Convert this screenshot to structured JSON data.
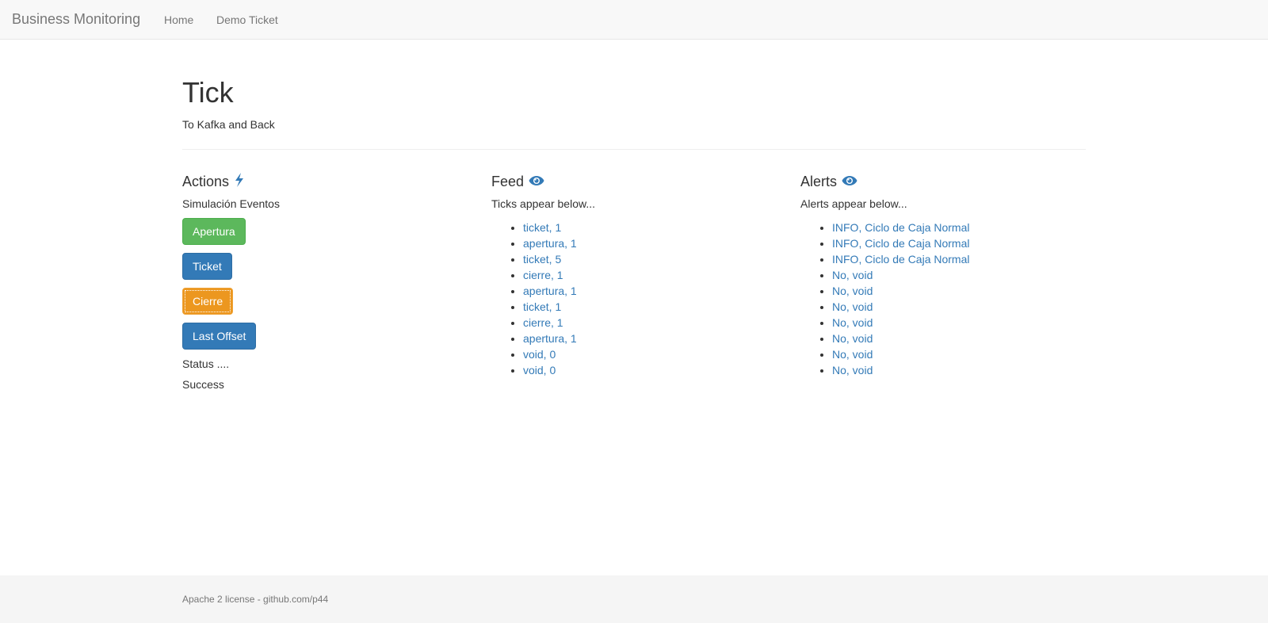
{
  "navbar": {
    "brand": "Business Monitoring",
    "links": [
      "Home",
      "Demo Ticket"
    ]
  },
  "header": {
    "title": "Tick",
    "subtitle": "To Kafka and Back"
  },
  "actions": {
    "heading": "Actions",
    "icon": "bolt-icon",
    "description": "Simulación Eventos",
    "buttons": [
      "Apertura",
      "Ticket",
      "Cierre",
      "Last Offset"
    ],
    "status_label": "Status ....",
    "status_value": "Success"
  },
  "feed": {
    "heading": "Feed",
    "icon": "eye-icon",
    "description": "Ticks appear below...",
    "items": [
      "ticket, 1",
      "apertura, 1",
      "ticket, 5",
      "cierre, 1",
      "apertura, 1",
      "ticket, 1",
      "cierre, 1",
      "apertura, 1",
      "void, 0",
      "void, 0"
    ]
  },
  "alerts": {
    "heading": "Alerts",
    "icon": "eye-icon",
    "description": "Alerts appear below...",
    "items": [
      "INFO, Ciclo de Caja Normal",
      "INFO, Ciclo de Caja Normal",
      "INFO, Ciclo de Caja Normal",
      "No, void",
      "No, void",
      "No, void",
      "No, void",
      "No, void",
      "No, void",
      "No, void"
    ]
  },
  "footer": {
    "text": "Apache 2 license - github.com/p44"
  },
  "colors": {
    "link": "#337ab7",
    "success": "#5cb85c",
    "primary": "#337ab7",
    "warning": "#ec971f"
  }
}
